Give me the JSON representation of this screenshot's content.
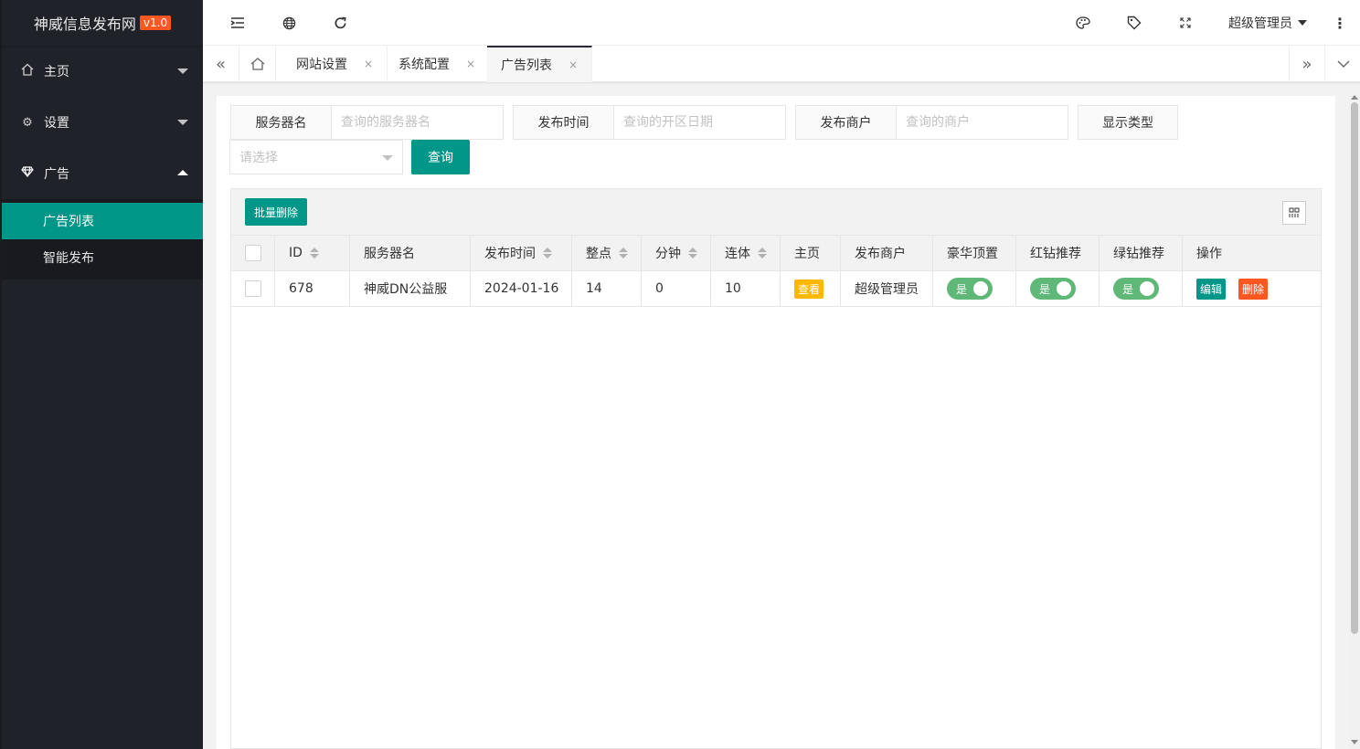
{
  "app": {
    "title": "神威信息发布网",
    "version": "v1.0"
  },
  "sidebar": {
    "items": [
      {
        "label": "主页",
        "icon": "home-icon"
      },
      {
        "label": "设置",
        "icon": "gear-icon"
      },
      {
        "label": "广告",
        "icon": "diamond-icon"
      }
    ],
    "sub_items": [
      {
        "label": "广告列表",
        "active": true
      },
      {
        "label": "智能发布",
        "active": false
      }
    ]
  },
  "header": {
    "icons": [
      "menu-fold-icon",
      "globe-icon",
      "refresh-icon",
      "palette-icon",
      "tag-icon",
      "fullscreen-icon"
    ],
    "user": "超级管理员",
    "more": "more-vertical-icon"
  },
  "tabs": {
    "items": [
      {
        "label": "网站设置",
        "close": "×"
      },
      {
        "label": "系统配置",
        "close": "×"
      },
      {
        "label": "广告列表",
        "close": "×",
        "active": true
      }
    ]
  },
  "search": {
    "server_label": "服务器名",
    "server_placeholder": "查询的服务器名",
    "time_label": "发布时间",
    "time_placeholder": "查询的开区日期",
    "merchant_label": "发布商户",
    "merchant_placeholder": "查询的商户",
    "type_label": "显示类型",
    "select_placeholder": "请选择",
    "query_button": "查询"
  },
  "table": {
    "batch_delete": "批量删除",
    "headers": [
      "ID",
      "服务器名",
      "发布时间",
      "整点",
      "分钟",
      "连体",
      "主页",
      "发布商户",
      "豪华顶置",
      "红钻推荐",
      "绿钻推荐",
      "操作"
    ],
    "rows": [
      {
        "id": "678",
        "server": "神威DN公益服",
        "time": "2024-01-16",
        "hour": "14",
        "minute": "0",
        "combo": "10",
        "home": "查看",
        "merchant": "超级管理员",
        "luxury_top": "是",
        "red_diamond": "是",
        "green_diamond": "是",
        "edit": "编辑",
        "delete": "删除"
      }
    ]
  },
  "colors": {
    "primary": "#009688",
    "sidebar_bg": "#20222a",
    "danger": "#ff5722",
    "warning": "#ffb800",
    "switch_on": "#5fb878"
  }
}
